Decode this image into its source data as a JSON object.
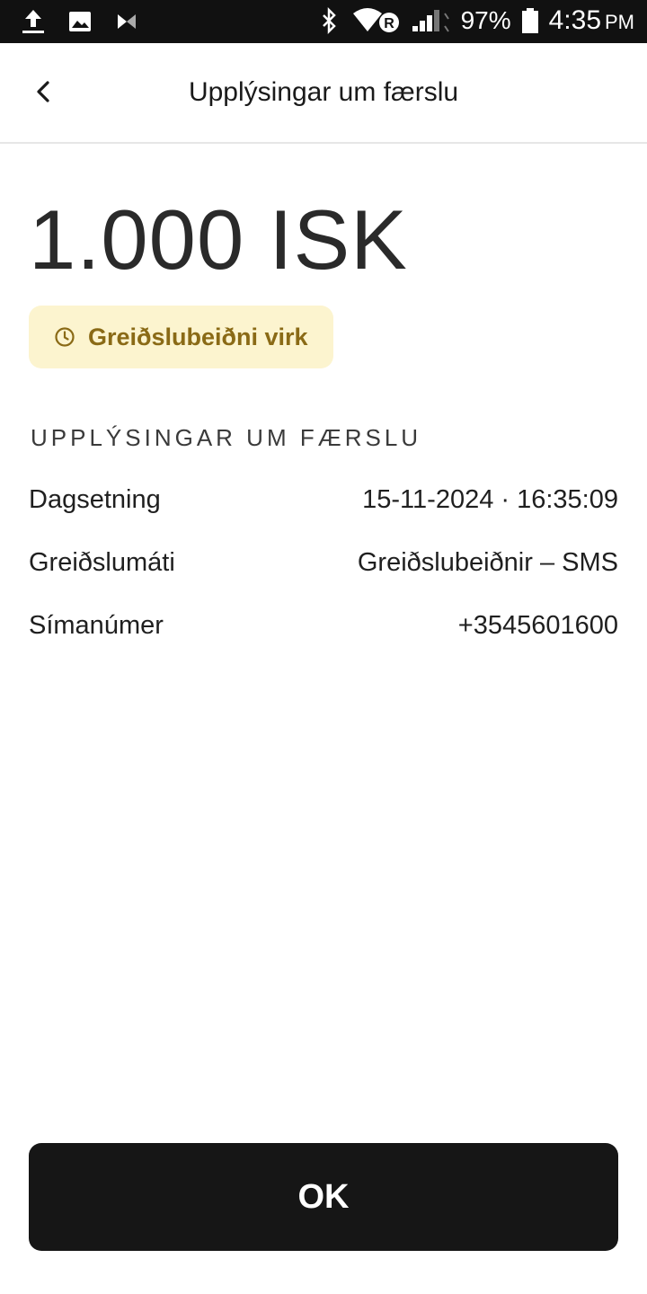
{
  "status_bar": {
    "icons_left": [
      "upload-icon",
      "image-icon",
      "app-icon"
    ],
    "icons_right": [
      "bluetooth-icon",
      "wifi-icon",
      "signal-icon",
      "battery-icon"
    ],
    "battery_percent": "97%",
    "time": "4:35",
    "ampm": "PM"
  },
  "header": {
    "title": "Upplýsingar um færslu",
    "back_icon": "chevron-left-icon"
  },
  "amount": "1.000 ISK",
  "status_badge": {
    "icon": "clock-icon",
    "label": "Greiðslubeiðni virk",
    "background": "#fcf4cf",
    "text_color": "#8a6a16"
  },
  "details": {
    "heading": "UPPLÝSINGAR UM FÆRSLU",
    "rows": [
      {
        "label": "Dagsetning",
        "value": "15-11-2024 · 16:35:09"
      },
      {
        "label": "Greiðslumáti",
        "value": "Greiðslubeiðnir – SMS"
      },
      {
        "label": "Símanúmer",
        "value": "+3545601600"
      }
    ]
  },
  "ok_button": {
    "label": "OK",
    "background": "#161616"
  }
}
